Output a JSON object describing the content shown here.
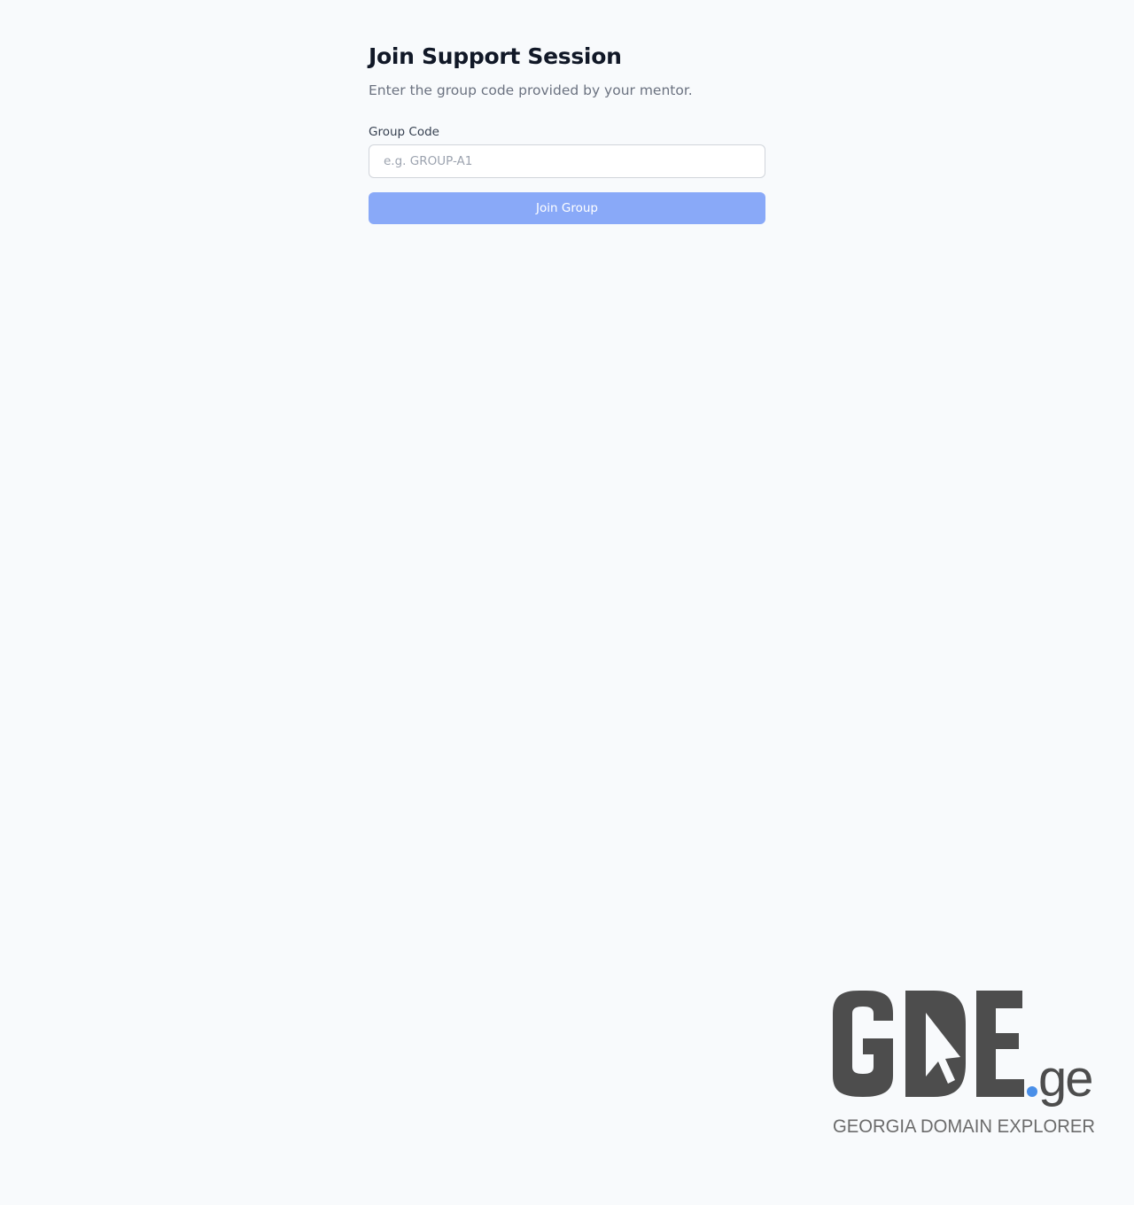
{
  "form": {
    "title": "Join Support Session",
    "subtitle": "Enter the group code provided by your mentor.",
    "group_code_label": "Group Code",
    "group_code_placeholder": "e.g. GROUP-A1",
    "group_code_value": "",
    "join_button_label": "Join Group"
  },
  "logo": {
    "wordmark": "GDE.ge",
    "tagline": "GEORGIA DOMAIN EXPLORER"
  },
  "colors": {
    "background": "#f8fafc",
    "button": "#89a9f8",
    "logo_gray": "#4d4d4d",
    "logo_dot": "#4a8fe8"
  }
}
